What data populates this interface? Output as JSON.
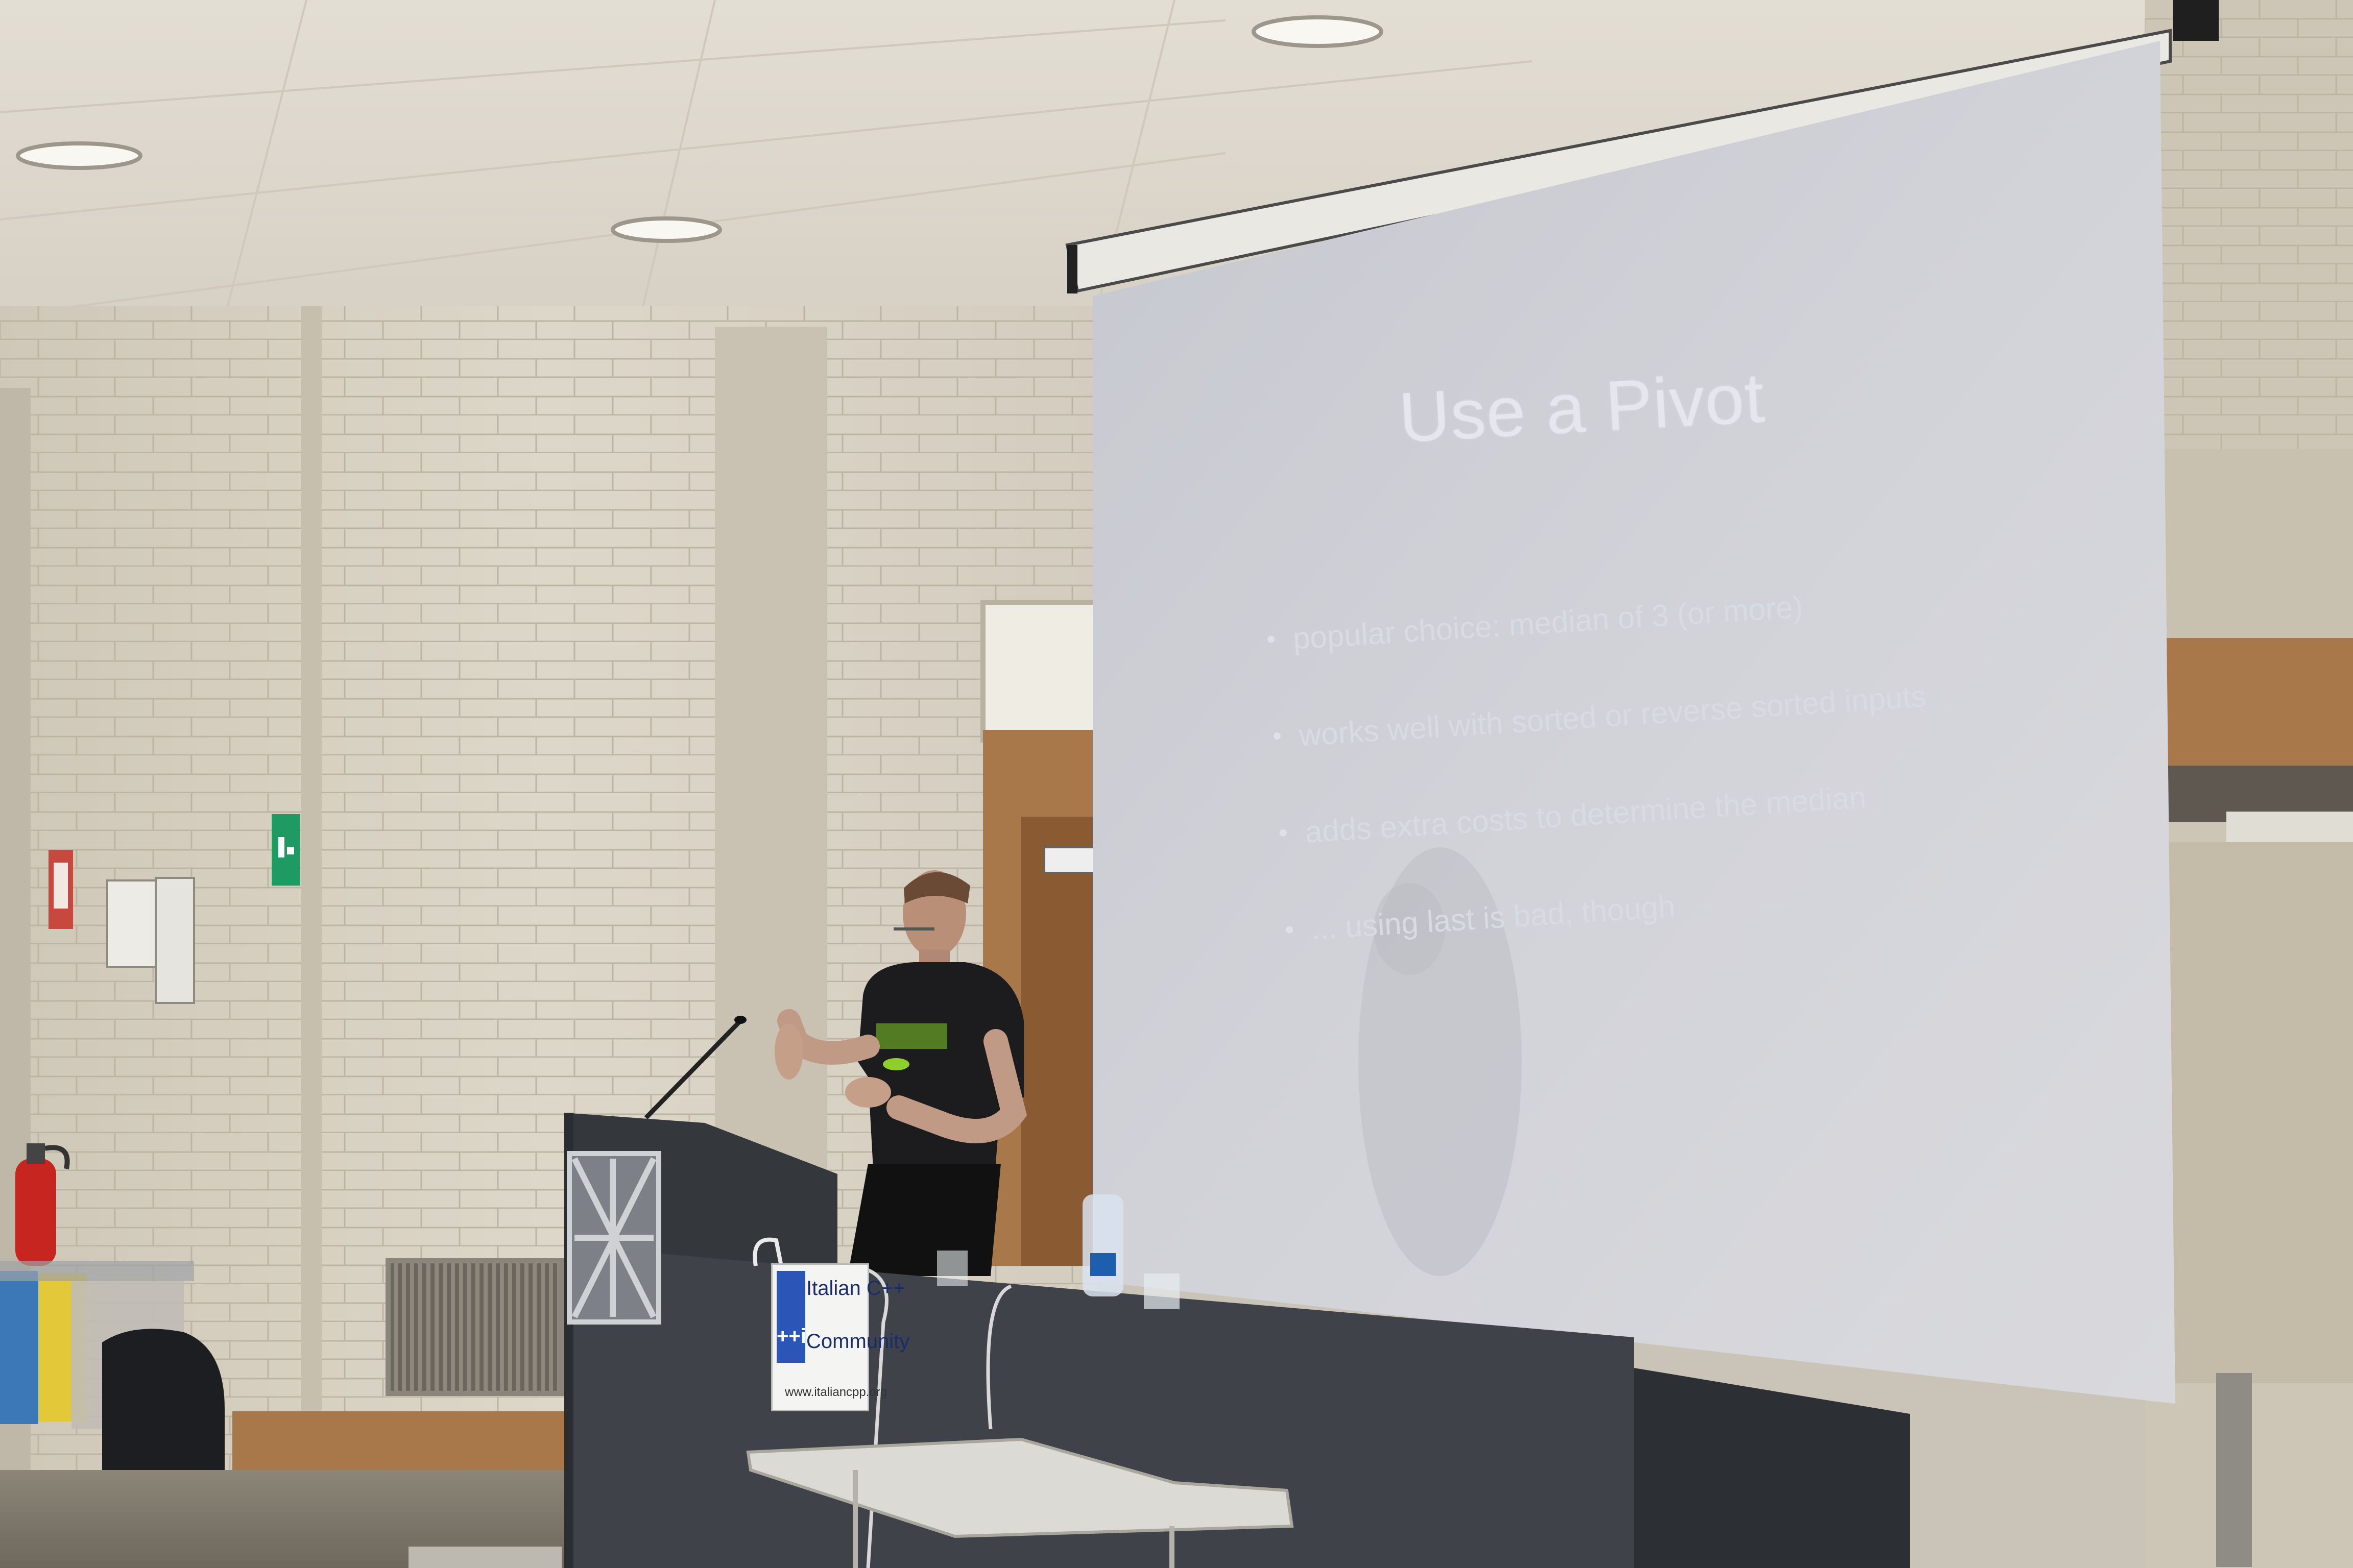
{
  "slide": {
    "title": "Use a Pivot",
    "bullets": [
      "popular choice: median of 3 (or more)",
      "works well with sorted or reverse sorted inputs",
      "adds extra costs to determine the median",
      "... using last is bad, though"
    ]
  },
  "lectern_sign": {
    "logo_mark": "++it",
    "line1": "Italian C++",
    "line2": "Community",
    "url": "www.italiancpp.org"
  },
  "colors": {
    "wall": "#d8d1c2",
    "ceiling": "#e2ddd3",
    "screen": "#d4d5da",
    "lectern": "#3f4349",
    "wood_trim": "#a9784a",
    "shirt_print": "#8fcf2a"
  }
}
